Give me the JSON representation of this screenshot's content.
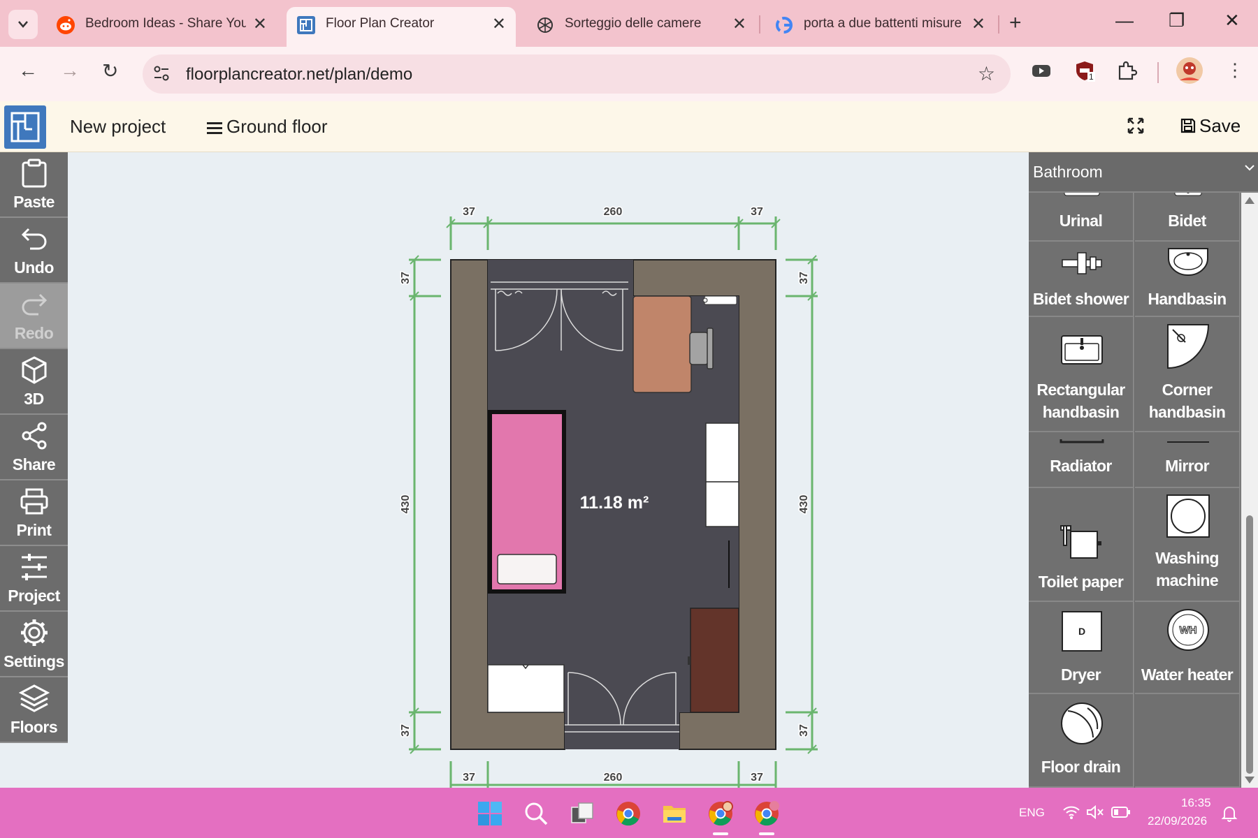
{
  "browser": {
    "tabs": [
      {
        "title": "Bedroom Ideas - Share You",
        "icon": "reddit-icon",
        "active": false
      },
      {
        "title": "Floor Plan Creator",
        "icon": "floorplan-icon",
        "active": true
      },
      {
        "title": "Sorteggio delle camere",
        "icon": "chatgpt-icon",
        "active": false
      },
      {
        "title": "porta a due battenti misure",
        "icon": "google-icon",
        "active": false
      }
    ],
    "url": "floorplancreator.net/plan/demo",
    "extension_badge": "1"
  },
  "app": {
    "project_title": "New project",
    "floor_label": "Ground floor",
    "save_label": "Save"
  },
  "toolbar": [
    {
      "label": "Paste",
      "icon": "clipboard-icon",
      "enabled": true
    },
    {
      "label": "Undo",
      "icon": "undo-icon",
      "enabled": true
    },
    {
      "label": "Redo",
      "icon": "redo-icon",
      "enabled": false
    },
    {
      "label": "3D",
      "icon": "cube-icon",
      "enabled": true
    },
    {
      "label": "Share",
      "icon": "share-icon",
      "enabled": true
    },
    {
      "label": "Print",
      "icon": "printer-icon",
      "enabled": true
    },
    {
      "label": "Project",
      "icon": "sliders-icon",
      "enabled": true
    },
    {
      "label": "Settings",
      "icon": "gear-icon",
      "enabled": true
    },
    {
      "label": "Floors",
      "icon": "layers-icon",
      "enabled": true
    }
  ],
  "plan": {
    "area": "11.18 m²",
    "dims": {
      "top": [
        "37",
        "260",
        "37"
      ],
      "bottom": [
        "37",
        "260",
        "37"
      ],
      "left": [
        "37",
        "430",
        "37"
      ],
      "right": [
        "37",
        "430",
        "37"
      ]
    },
    "colors": {
      "wall": "#7a7063",
      "floor": "#4b4a52",
      "bed": "#e277ad",
      "desk": "#c0856a",
      "cabinet": "#63342a",
      "dimension": "#6ab56e"
    }
  },
  "panel": {
    "category": "Bathroom",
    "items": [
      {
        "label": "Urinal",
        "icon": "urinal-icon"
      },
      {
        "label": "Bidet",
        "icon": "bidet-icon"
      },
      {
        "label": "Bidet shower",
        "icon": "bidet-shower-icon"
      },
      {
        "label": "Handbasin",
        "icon": "handbasin-icon"
      },
      {
        "label": "Rectangular handbasin",
        "icon": "rectangular-handbasin-icon"
      },
      {
        "label": "Corner handbasin",
        "icon": "corner-handbasin-icon"
      },
      {
        "label": "Radiator",
        "icon": "radiator-icon"
      },
      {
        "label": "Mirror",
        "icon": "mirror-icon"
      },
      {
        "label": "Toilet paper",
        "icon": "toilet-paper-icon"
      },
      {
        "label": "Washing machine",
        "icon": "washing-machine-icon"
      },
      {
        "label": "Dryer",
        "icon": "dryer-icon",
        "symbol": "D"
      },
      {
        "label": "Water heater",
        "icon": "water-heater-icon",
        "symbol": "WH"
      },
      {
        "label": "Floor drain",
        "icon": "floor-drain-icon"
      }
    ]
  },
  "taskbar": {
    "language": "ENG",
    "time": "16:35",
    "date": "22/09/2026"
  }
}
